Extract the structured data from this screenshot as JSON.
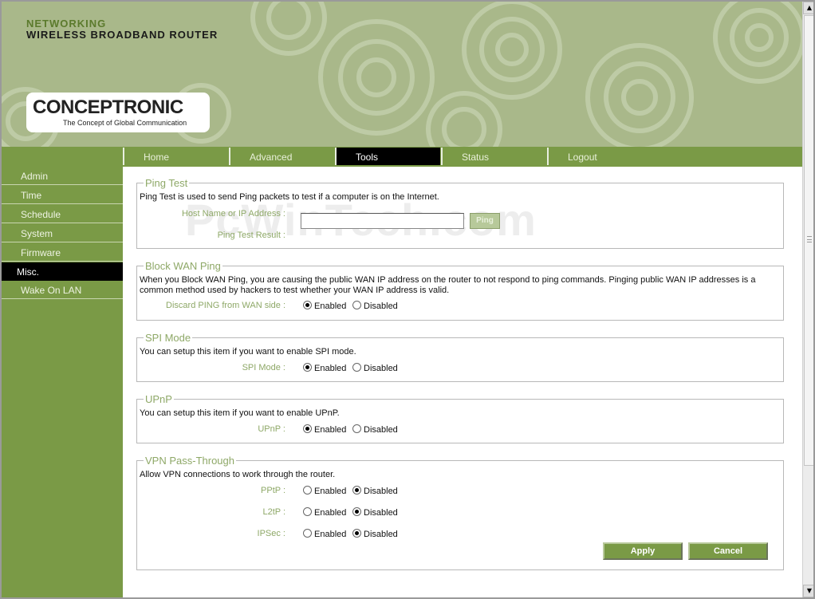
{
  "header": {
    "line1": "NETWORKING",
    "line2": "WIRELESS BROADBAND ROUTER",
    "logo": "CONCEPTRONIC",
    "tagline": "The Concept of Global Communication"
  },
  "nav": {
    "tabs": [
      {
        "label": "Home"
      },
      {
        "label": "Advanced"
      },
      {
        "label": "Tools",
        "active": true
      },
      {
        "label": "Status"
      },
      {
        "label": "Logout"
      }
    ]
  },
  "sidebar": {
    "items": [
      {
        "label": "Admin"
      },
      {
        "label": "Time"
      },
      {
        "label": "Schedule"
      },
      {
        "label": "System"
      },
      {
        "label": "Firmware"
      },
      {
        "label": "Misc.",
        "active": true
      },
      {
        "label": "Wake On LAN"
      }
    ]
  },
  "watermark": "PcWinTech.com",
  "ping": {
    "legend": "Ping Test",
    "desc": "Ping Test is used to send Ping packets to test if a computer is on the Internet.",
    "host_label": "Host Name or IP Address :",
    "host_value": "",
    "ping_btn": "Ping",
    "result_label": "Ping Test Result :"
  },
  "wan_ping": {
    "legend": "Block WAN Ping",
    "desc": "When you Block WAN Ping, you are causing the public WAN IP address on the router to not respond to ping commands. Pinging public WAN IP addresses is a common method used by hackers to test whether your WAN IP address is valid.",
    "label": "Discard PING from WAN side :",
    "value": "Enabled"
  },
  "spi": {
    "legend": "SPI Mode",
    "desc": "You can setup this item if you want to enable SPI mode.",
    "label": "SPI Mode :",
    "value": "Enabled"
  },
  "upnp": {
    "legend": "UPnP",
    "desc": "You can setup this item if you want to enable UPnP.",
    "label": "UPnP :",
    "value": "Enabled"
  },
  "vpn": {
    "legend": "VPN Pass-Through",
    "desc": "Allow VPN connections to work through the router.",
    "pptp_label": "PPtP :",
    "pptp_value": "Disabled",
    "l2tp_label": "L2tP :",
    "l2tp_value": "Disabled",
    "ipsec_label": "IPSec :",
    "ipsec_value": "Disabled"
  },
  "options": {
    "enabled": "Enabled",
    "disabled": "Disabled"
  },
  "buttons": {
    "apply": "Apply",
    "cancel": "Cancel"
  },
  "colors": {
    "brand_green": "#7a9a46",
    "header_green": "#a9b88a",
    "label_green": "#8ea867"
  }
}
